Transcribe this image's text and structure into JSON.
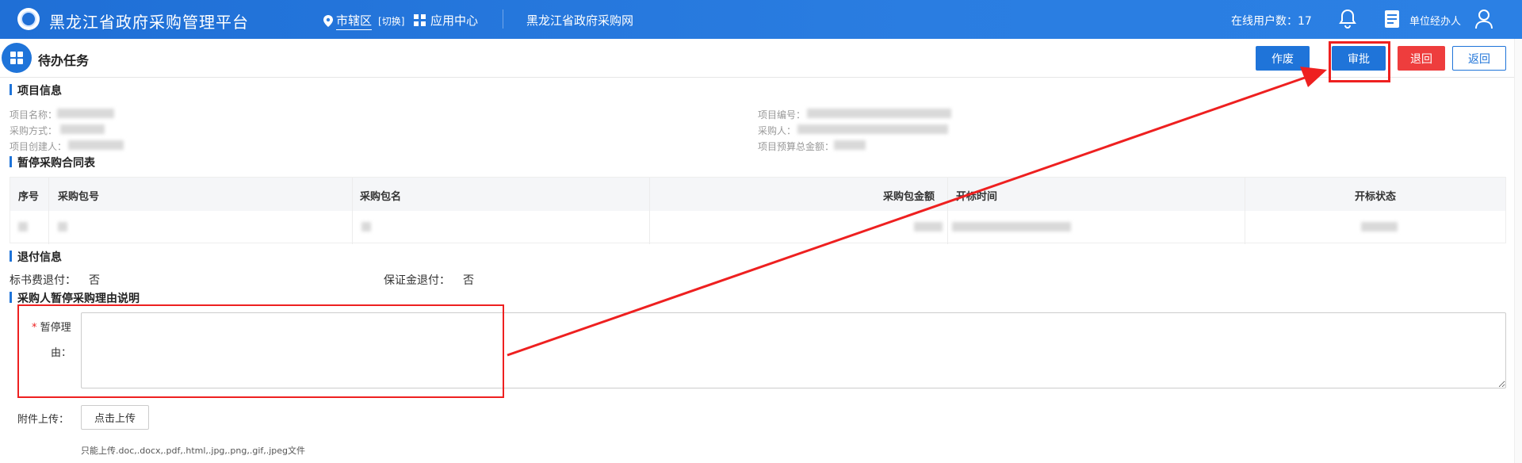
{
  "header": {
    "app_title": "黑龙江省政府采购管理平台",
    "region_name": "市辖区",
    "region_switch": "[切换]",
    "app_center": "应用中心",
    "portal_link": "黑龙江省政府采购网",
    "online_users": "在线用户数：17",
    "user_role": "单位经办人"
  },
  "page": {
    "title": "待办任务",
    "buttons": {
      "void": "作废",
      "approve": "审批",
      "back": "退回",
      "return": "返回"
    }
  },
  "project_info": {
    "title": "项目信息",
    "name_label": "项目名称：",
    "method_label": "采购方式：",
    "creator_label": "项目创建人：",
    "code_label": "项目编号：",
    "purchaser_label": "采购人：",
    "budget_label": "项目预算总金额："
  },
  "contract_table": {
    "title": "暂停采购合同表",
    "columns": [
      "序号",
      "采购包号",
      "采购包名",
      "采购包金额",
      "开标时间",
      "开标状态"
    ]
  },
  "refund_info": {
    "title": "退付信息",
    "doc_fee_label": "标书费退付：",
    "doc_fee_value": "否",
    "deposit_label": "保证金退付：",
    "deposit_value": "否"
  },
  "reason": {
    "section_title": "采购人暂停采购理由说明",
    "label_star": "*",
    "label_part1": "暂停理",
    "label_part2": "由：",
    "value": "",
    "upload_label": "附件上传：",
    "upload_button": "点击上传",
    "upload_hint": "只能上传.doc,.docx,.pdf,.html,.jpg,.png,.gif,.jpeg文件"
  },
  "colors": {
    "primary": "#1f74d9",
    "danger": "#ee3d3d",
    "highlight": "#ee2020"
  }
}
